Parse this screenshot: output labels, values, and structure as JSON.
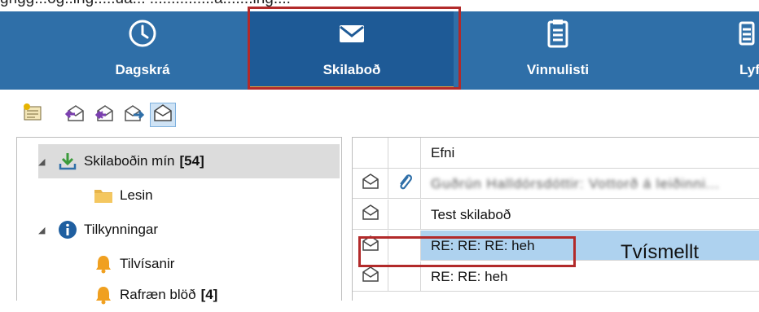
{
  "top_fragment": "grigg...og..ing.....ua... ...............a.......ing....",
  "ribbon": {
    "tabs": [
      {
        "label": "Dagskrá",
        "icon": "clock-icon"
      },
      {
        "label": "Skilaboð",
        "icon": "envelope-icon",
        "selected": true
      },
      {
        "label": "Vinnulisti",
        "icon": "clipboard-icon"
      },
      {
        "label": "Lyfjaen",
        "icon": "list-icon"
      }
    ]
  },
  "toolbar": {
    "buttons": [
      "new-message-icon",
      "reply-icon",
      "reply-all-icon",
      "forward-icon",
      "open-envelope-icon"
    ]
  },
  "tree": {
    "items": [
      {
        "label": "Skilaboðin mín",
        "count": "[54]",
        "icon": "download-icon"
      },
      {
        "label": "Lesin",
        "icon": "folder-icon"
      },
      {
        "label": "Tilkynningar",
        "icon": "info-icon"
      },
      {
        "label": "Tilvísanir",
        "icon": "bell-icon"
      },
      {
        "label": "Rafræn blöð",
        "count": "[4]",
        "icon": "bell-icon"
      }
    ]
  },
  "list": {
    "header": "Efni",
    "rows": [
      {
        "subject": "Guðrún Halldórsdóttir: Vottorð á leiðinni...",
        "attachment": true
      },
      {
        "subject": "Test skilaboð",
        "attachment": false
      },
      {
        "subject": "RE: RE: RE: heh",
        "attachment": false
      },
      {
        "subject": "RE: RE: heh",
        "attachment": false
      }
    ]
  },
  "annotation": {
    "double_click": "Tvísmellt"
  },
  "colors": {
    "ribbon": "#2f6fa8",
    "ribbon_selected": "#1e5a96",
    "accent_underline": "#e8a13a",
    "highlight_box": "#b22a2a",
    "row_selected": "#aed2ef"
  }
}
